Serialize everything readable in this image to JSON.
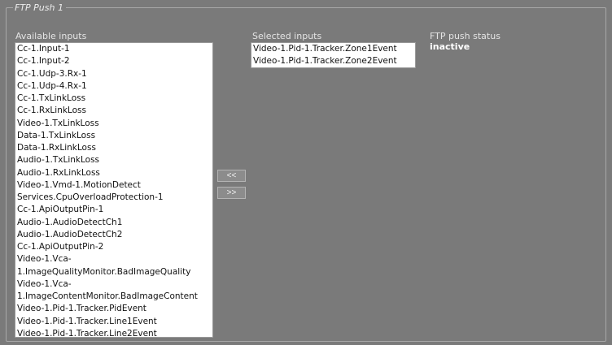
{
  "panel": {
    "legend": "FTP Push 1"
  },
  "available": {
    "header": "Available inputs",
    "items": [
      "Cc-1.Input-1",
      "Cc-1.Input-2",
      "Cc-1.Udp-3.Rx-1",
      "Cc-1.Udp-4.Rx-1",
      "Cc-1.TxLinkLoss",
      "Cc-1.RxLinkLoss",
      "Video-1.TxLinkLoss",
      "Data-1.TxLinkLoss",
      "Data-1.RxLinkLoss",
      "Audio-1.TxLinkLoss",
      "Audio-1.RxLinkLoss",
      "Video-1.Vmd-1.MotionDetect",
      "Services.CpuOverloadProtection-1",
      "Cc-1.ApiOutputPin-1",
      "Audio-1.AudioDetectCh1",
      "Audio-1.AudioDetectCh2",
      "Cc-1.ApiOutputPin-2",
      "Video-1.Vca-",
      "1.ImageQualityMonitor.BadImageQuality",
      "Video-1.Vca-",
      "1.ImageContentMonitor.BadImageContent",
      "Video-1.Pid-1.Tracker.PidEvent",
      "Video-1.Pid-1.Tracker.Line1Event",
      "Video-1.Pid-1.Tracker.Line2Event"
    ]
  },
  "buttons": {
    "remove_label": "<<",
    "add_label": ">>"
  },
  "selected": {
    "header": "Selected inputs",
    "items": [
      "Video-1.Pid-1.Tracker.Zone1Event",
      "Video-1.Pid-1.Tracker.Zone2Event"
    ]
  },
  "status": {
    "header": "FTP push status",
    "value": "inactive"
  }
}
